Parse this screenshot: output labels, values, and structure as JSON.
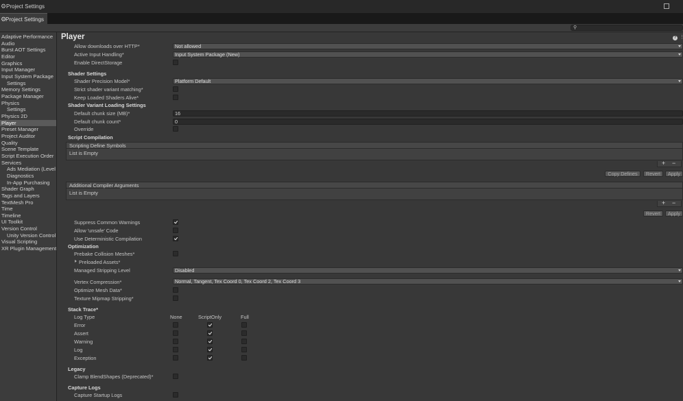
{
  "window": {
    "title": "Project Settings",
    "tab_label": "Project Settings"
  },
  "sidebar": {
    "items": [
      {
        "label": "Adaptive Performance",
        "sub": false
      },
      {
        "label": "Audio",
        "sub": false
      },
      {
        "label": "Burst AOT Settings",
        "sub": false
      },
      {
        "label": "Editor",
        "sub": false
      },
      {
        "label": "Graphics",
        "sub": false
      },
      {
        "label": "Input Manager",
        "sub": false
      },
      {
        "label": "Input System Package",
        "sub": false
      },
      {
        "label": "Settings",
        "sub": true
      },
      {
        "label": "Memory Settings",
        "sub": false
      },
      {
        "label": "Package Manager",
        "sub": false
      },
      {
        "label": "Physics",
        "sub": false
      },
      {
        "label": "Settings",
        "sub": true
      },
      {
        "label": "Physics 2D",
        "sub": false
      },
      {
        "label": "Player",
        "sub": false,
        "selected": true
      },
      {
        "label": "Preset Manager",
        "sub": false
      },
      {
        "label": "Project Auditor",
        "sub": false
      },
      {
        "label": "Quality",
        "sub": false
      },
      {
        "label": "Scene Template",
        "sub": false
      },
      {
        "label": "Script Execution Order",
        "sub": false
      },
      {
        "label": "Services",
        "sub": false
      },
      {
        "label": "Ads Mediation (Level",
        "sub": true
      },
      {
        "label": "Diagnostics",
        "sub": true
      },
      {
        "label": "In-App Purchasing",
        "sub": true
      },
      {
        "label": "Shader Graph",
        "sub": false
      },
      {
        "label": "Tags and Layers",
        "sub": false
      },
      {
        "label": "TextMesh Pro",
        "sub": false
      },
      {
        "label": "Time",
        "sub": false
      },
      {
        "label": "Timeline",
        "sub": false
      },
      {
        "label": "UI Toolkit",
        "sub": false
      },
      {
        "label": "Version Control",
        "sub": false
      },
      {
        "label": "Unity Version Control",
        "sub": true
      },
      {
        "label": "Visual Scripting",
        "sub": false
      },
      {
        "label": "XR Plugin Management",
        "sub": false
      }
    ]
  },
  "main": {
    "title": "Player",
    "allow_http": {
      "label": "Allow downloads over HTTP*",
      "value": "Not allowed"
    },
    "active_input": {
      "label": "Active Input Handling*",
      "value": "Input System Package (New)"
    },
    "enable_directstorage": {
      "label": "Enable DirectStorage",
      "checked": false
    },
    "shader_settings": {
      "header": "Shader Settings",
      "precision": {
        "label": "Shader Precision Model*",
        "value": "Platform Default"
      },
      "strict_variant": {
        "label": "Strict shader variant matching*",
        "checked": false
      },
      "keep_loaded": {
        "label": "Keep Loaded Shaders Alive*",
        "checked": false
      }
    },
    "variant_loading": {
      "header": "Shader Variant Loading Settings",
      "chunk_size": {
        "label": "Default chunk size (MB)*",
        "value": "16"
      },
      "chunk_count": {
        "label": "Default chunk count*",
        "value": "0"
      },
      "override": {
        "label": "Override",
        "checked": false
      }
    },
    "script_compilation": {
      "header": "Script Compilation",
      "define_symbols": {
        "header": "Scripting Define Symbols",
        "empty": "List is Empty"
      },
      "plus": "+",
      "minus": "−",
      "copy_defines": "Copy Defines",
      "revert": "Revert",
      "apply": "Apply",
      "compiler_args": {
        "header": "Additional Compiler Arguments",
        "empty": "List is Empty"
      },
      "revert2": "Revert",
      "apply2": "Apply",
      "suppress_warnings": {
        "label": "Suppress Common Warnings",
        "checked": true
      },
      "allow_unsafe": {
        "label": "Allow 'unsafe' Code",
        "checked": false
      },
      "deterministic": {
        "label": "Use Deterministic Compilation",
        "checked": true
      }
    },
    "optimization": {
      "header": "Optimization",
      "prebake": {
        "label": "Prebake Collision Meshes*",
        "checked": false
      },
      "preloaded": {
        "label": "Preloaded Assets*"
      },
      "stripping": {
        "label": "Managed Stripping Level",
        "value": "Disabled"
      },
      "vertex_compression": {
        "label": "Vertex Compression*",
        "value": "Normal, Tangent, Tex Coord 0, Tex Coord 2, Tex Coord 3"
      },
      "optimize_mesh": {
        "label": "Optimize Mesh Data*",
        "checked": false
      },
      "mipmap_stripping": {
        "label": "Texture Mipmap Stripping*",
        "checked": false
      }
    },
    "stack_trace": {
      "header": "Stack Trace*",
      "col_label": "Log Type",
      "columns": [
        "None",
        "ScriptOnly",
        "Full"
      ],
      "rows": [
        {
          "label": "Error",
          "checks": [
            false,
            true,
            false
          ]
        },
        {
          "label": "Assert",
          "checks": [
            false,
            true,
            false
          ]
        },
        {
          "label": "Warning",
          "checks": [
            false,
            true,
            false
          ]
        },
        {
          "label": "Log",
          "checks": [
            false,
            true,
            false
          ]
        },
        {
          "label": "Exception",
          "checks": [
            false,
            true,
            false
          ]
        }
      ]
    },
    "legacy": {
      "header": "Legacy",
      "clamp": {
        "label": "Clamp BlendShapes (Deprecated)*",
        "checked": false
      }
    },
    "capture_logs": {
      "header": "Capture Logs",
      "startup": {
        "label": "Capture Startup Logs",
        "checked": false
      }
    }
  }
}
